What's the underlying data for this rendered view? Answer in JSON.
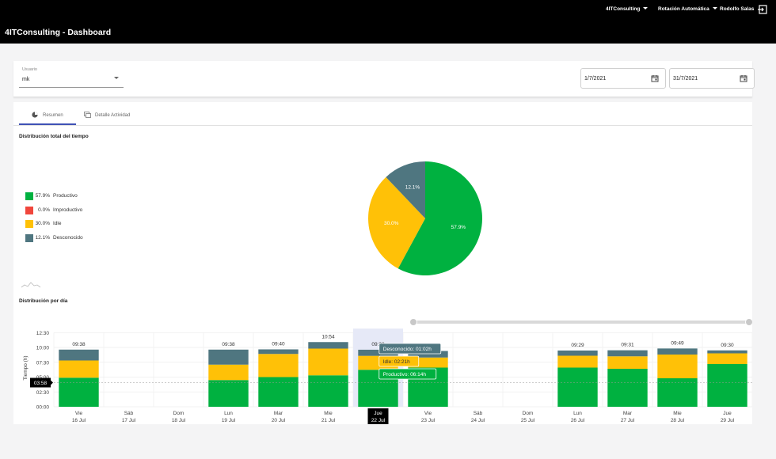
{
  "header": {
    "app_title": "4ITConsulting - Dashboard",
    "nav_company": "4ITConsulting",
    "nav_rotation": "Rotación Automática",
    "nav_user": "Rodolfo Salas"
  },
  "filters": {
    "user_label": "Usuario",
    "user_value": "mk",
    "date_from": "1/7/2021",
    "date_to": "31/7/2021"
  },
  "tabs": [
    {
      "label": "Resumen",
      "active": true,
      "icon": "pie-chart-icon"
    },
    {
      "label": "Detalle Actividad",
      "active": false,
      "icon": "detail-list-icon"
    }
  ],
  "pie_section": {
    "title": "Distribución total del tiempo",
    "legend": [
      {
        "pct": "57.9%",
        "name": "Productivo"
      },
      {
        "pct": "0.0%",
        "name": "Improductivo"
      },
      {
        "pct": "30.0%",
        "name": "Idle"
      },
      {
        "pct": "12.1%",
        "name": "Desconocido"
      }
    ]
  },
  "bar_section": {
    "title": "Distribución por día",
    "y_axis_label": "Tiempo (h)",
    "y_ticks": [
      "12:30",
      "10:00",
      "07:30",
      "05:00",
      "02:30",
      "00:00"
    ],
    "cursor_value": "03:58",
    "tooltip": {
      "unknown": "Desconocido: 01:02h",
      "idle": "Idle: 02:21h",
      "productive": "Productivo: 06:14h"
    }
  },
  "colors": {
    "productivo": "#00b140",
    "improductivo": "#f0463c",
    "idle": "#ffc107",
    "desconocido": "#4f7680",
    "topbar": "#000000",
    "tab_active": "#3f51b5"
  },
  "chart_data": [
    {
      "type": "pie",
      "title": "Distribución total del tiempo",
      "slices": [
        {
          "label": "Productivo",
          "value": 57.9,
          "display": "57.9%"
        },
        {
          "label": "Improductivo",
          "value": 0.0,
          "display": "0.0%"
        },
        {
          "label": "Idle",
          "value": 30.0,
          "display": "30.0%"
        },
        {
          "label": "Desconocido",
          "value": 12.1,
          "display": "12.1%"
        }
      ]
    },
    {
      "type": "bar",
      "stacked": true,
      "title": "Distribución por día",
      "ylabel": "Tiempo (h)",
      "ylim": [
        0,
        12.5
      ],
      "grid": true,
      "categories": [
        {
          "day": "Vie",
          "date": "16 Jul"
        },
        {
          "day": "Sáb",
          "date": "17 Jul"
        },
        {
          "day": "Dom",
          "date": "18 Jul"
        },
        {
          "day": "Lun",
          "date": "19 Jul"
        },
        {
          "day": "Mar",
          "date": "20 Jul"
        },
        {
          "day": "Mie",
          "date": "21 Jul"
        },
        {
          "day": "Jue",
          "date": "22 Jul"
        },
        {
          "day": "Vie",
          "date": "23 Jul"
        },
        {
          "day": "Sáb",
          "date": "24 Jul"
        },
        {
          "day": "Dom",
          "date": "25 Jul"
        },
        {
          "day": "Lun",
          "date": "26 Jul"
        },
        {
          "day": "Mar",
          "date": "27 Jul"
        },
        {
          "day": "Mie",
          "date": "28 Jul"
        },
        {
          "day": "Jue",
          "date": "29 Jul"
        }
      ],
      "totals": [
        "09:38",
        "",
        "",
        "09:38",
        "09:40",
        "10:54",
        "09:38",
        "09:24",
        "",
        "",
        "09:29",
        "09:31",
        "09:49",
        "09:30"
      ],
      "highlighted_index": 6,
      "series": [
        {
          "name": "Productivo",
          "values": [
            4.9,
            0,
            0,
            4.5,
            5.0,
            5.3,
            6.23,
            6.6,
            0,
            0,
            6.6,
            6.4,
            4.8,
            7.2
          ]
        },
        {
          "name": "Idle",
          "values": [
            2.9,
            0,
            0,
            2.6,
            3.9,
            4.5,
            2.35,
            1.7,
            0,
            0,
            2.0,
            2.1,
            4.0,
            1.8
          ]
        },
        {
          "name": "Desconocido",
          "values": [
            1.83,
            0,
            0,
            2.53,
            0.77,
            1.1,
            1.03,
            1.1,
            0,
            0,
            0.88,
            1.02,
            1.02,
            0.5
          ]
        }
      ]
    }
  ]
}
